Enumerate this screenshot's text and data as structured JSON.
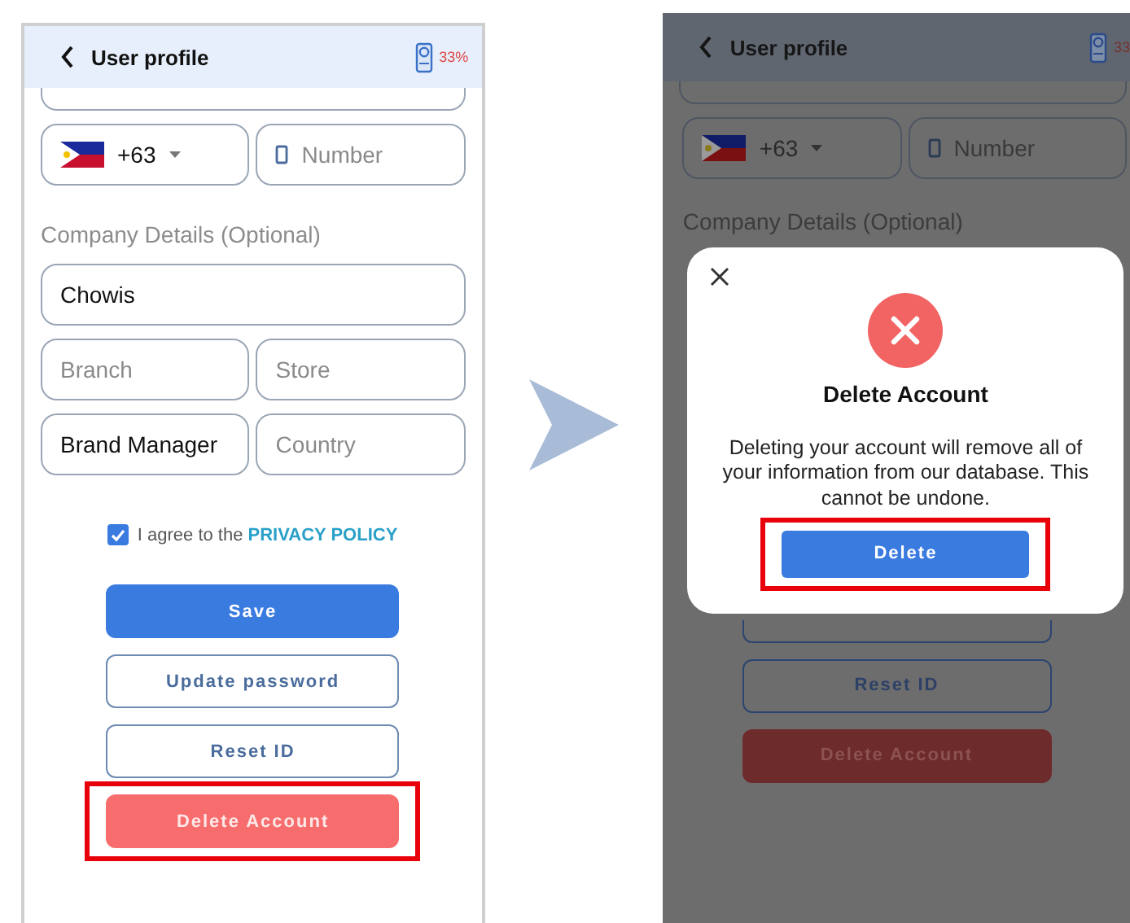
{
  "screens": [
    {
      "kind": "normal",
      "header": {
        "title": "User profile",
        "battery": "33%"
      },
      "phone": {
        "code": "+63",
        "placeholder": "Number"
      },
      "section_label": "Company Details (Optional)",
      "field_rows": [
        {
          "fields": [
            {
              "value": "Chowis"
            }
          ]
        },
        {
          "fields": [
            {
              "placeholder": "Branch"
            },
            {
              "placeholder": "Store"
            }
          ]
        },
        {
          "fields": [
            {
              "value": "Brand Manager"
            },
            {
              "placeholder": "Country"
            }
          ]
        }
      ],
      "agreement": {
        "checked": true,
        "text": "I agree to the ",
        "link": "PRIVACY POLICY"
      },
      "buttons": [
        {
          "label": "Save",
          "kind": "primary",
          "highlighted": false
        },
        {
          "label": "Update password",
          "kind": "outline",
          "highlighted": false
        },
        {
          "label": "Reset ID",
          "kind": "outline",
          "highlighted": false
        },
        {
          "label": "Delete Account",
          "kind": "danger",
          "highlighted": true
        }
      ]
    },
    {
      "kind": "dimmed",
      "header": {
        "title": "User profile",
        "battery": "33"
      },
      "phone": {
        "code": "+63",
        "placeholder": "Number"
      },
      "section_label": "Company Details (Optional)",
      "dialog": {
        "title": "Delete Account",
        "message": "Deleting your account will remove all of your information from our database. This cannot be undone.",
        "button": {
          "label": "Delete",
          "highlighted": true
        }
      },
      "buttons": [
        {
          "label": "Reset ID",
          "kind": "outline",
          "highlighted": false
        },
        {
          "label": "Delete Account",
          "kind": "danger",
          "highlighted": false
        }
      ]
    }
  ]
}
